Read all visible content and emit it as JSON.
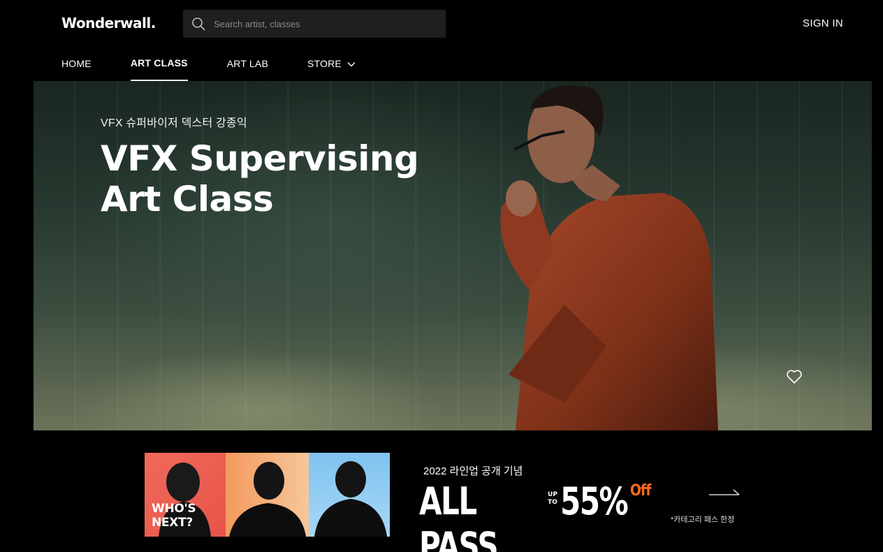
{
  "header": {
    "logo": "Wonderwall.",
    "search_placeholder": "Search artist, classes",
    "sign_in": "SIGN IN"
  },
  "nav": {
    "items": [
      {
        "label": "HOME",
        "active": false
      },
      {
        "label": "ART CLASS",
        "active": true
      },
      {
        "label": "ART LAB",
        "active": false
      },
      {
        "label": "STORE",
        "active": false,
        "has_dropdown": true
      }
    ]
  },
  "hero": {
    "subtitle": "VFX 슈퍼바이저 덱스터 강종익",
    "title_line1": "VFX Supervising",
    "title_line2": "Art Class",
    "favorite_icon": "heart-icon"
  },
  "banner": {
    "tile_text_line1": "WHO'S",
    "tile_text_line2": "NEXT?",
    "small_heading": "2022 라인업 공개 기념",
    "all_pass": "ALL PASS",
    "up": "UP",
    "to": "TO",
    "discount": "55%",
    "off": "Off",
    "note": "*카테고리 패스 한정",
    "arrow_icon": "arrow-right-icon",
    "accent_color": "#ff6a1f"
  },
  "colors": {
    "background": "#000000",
    "search_bg": "#1f1f1f",
    "text": "#ffffff"
  }
}
